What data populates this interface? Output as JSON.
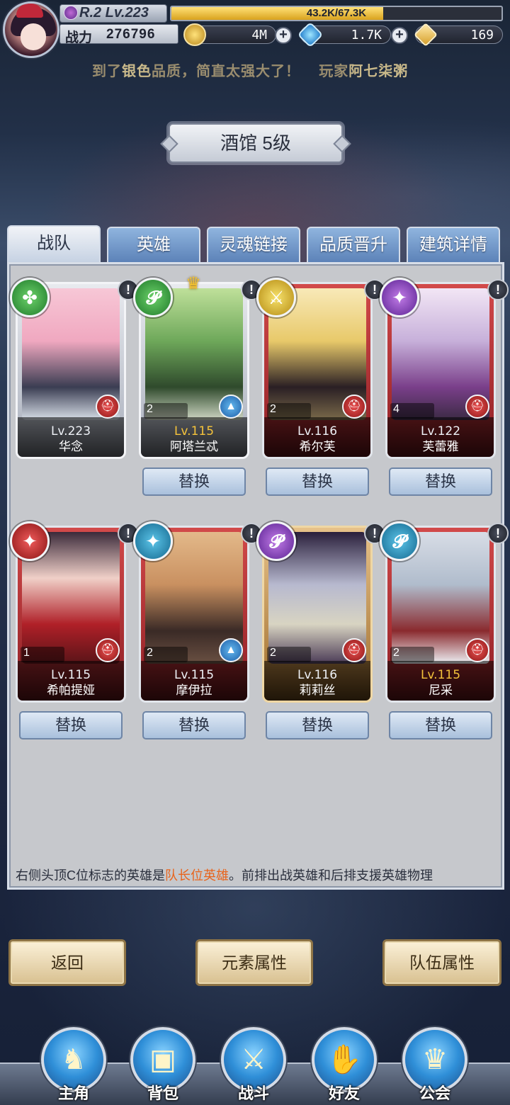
{
  "header": {
    "rank_level": "R.2 Lv.223",
    "xp_text": "43.2K/67.3K",
    "xp_progress": 0.642,
    "power_label": "战力",
    "power_value": "276796",
    "gold": "4M",
    "crystal": "1.7K",
    "ticket": "169",
    "marquee_prefix": "到了",
    "marquee_highlight": "银色",
    "marquee_middle": "品质，简直太强大了！",
    "marquee_player_prefix": "玩家",
    "marquee_player": "阿七柒粥"
  },
  "title": "酒馆 5级",
  "tabs": [
    "战队",
    "英雄",
    "灵魂链接",
    "品质晋升",
    "建筑详情"
  ],
  "heroes": [
    {
      "name": "华念",
      "level": "Lv.223",
      "star": "",
      "element_icon": "leaf",
      "element_glyph": "✤",
      "class_icon": "helmet",
      "class_glyph": "⛑",
      "gold_level": false,
      "swap": ""
    },
    {
      "name": "阿塔兰忒",
      "level": "Lv.115",
      "star": "2",
      "element_icon": "dark",
      "element_glyph": "𝓟",
      "class_icon": "wizard-hat",
      "class_glyph": "▲",
      "gold_level": true,
      "swap": "替换",
      "leader": true
    },
    {
      "name": "希尔芙",
      "level": "Lv.116",
      "star": "2",
      "element_icon": "sword",
      "element_glyph": "⚔",
      "class_icon": "helmet",
      "class_glyph": "⛑",
      "gold_level": false,
      "swap": "替换"
    },
    {
      "name": "芙蕾雅",
      "level": "Lv.122",
      "star": "4",
      "element_icon": "wing",
      "element_glyph": "✦",
      "class_icon": "helmet",
      "class_glyph": "⛑",
      "gold_level": false,
      "swap": "替换"
    },
    {
      "name": "希帕提娅",
      "level": "Lv.115",
      "star": "1",
      "element_icon": "wing",
      "element_glyph": "✦",
      "class_icon": "helmet",
      "class_glyph": "⛑",
      "gold_level": false,
      "swap": "替换"
    },
    {
      "name": "摩伊拉",
      "level": "Lv.115",
      "star": "2",
      "element_icon": "wing",
      "element_glyph": "✦",
      "class_icon": "wizard-hat",
      "class_glyph": "▲",
      "gold_level": false,
      "swap": "替换"
    },
    {
      "name": "莉莉丝",
      "level": "Lv.116",
      "star": "2",
      "element_icon": "dark",
      "element_glyph": "𝓟",
      "class_icon": "helmet",
      "class_glyph": "⛑",
      "gold_level": false,
      "swap": "替换"
    },
    {
      "name": "尼采",
      "level": "Lv.115",
      "star": "2",
      "element_icon": "dark",
      "element_glyph": "𝓟",
      "class_icon": "helmet",
      "class_glyph": "⛑",
      "gold_level": true,
      "swap": "替换"
    }
  ],
  "hint": {
    "prefix": "右侧头顶C位标志的英雄是",
    "highlight": "队长位英雄",
    "suffix": "。前排出战英雄和后排支援英雄物理"
  },
  "actions": {
    "back": "返回",
    "element_attr": "元素属性",
    "team_attr": "队伍属性"
  },
  "nav": [
    "主角",
    "背包",
    "战斗",
    "好友",
    "公会"
  ],
  "colors": {
    "tab_active": "#e9edf3",
    "tab_inactive": "#6f93c6",
    "card_red": "#c8383c",
    "accent_orange": "#e8641c",
    "xp_fill": "#e8b83a"
  }
}
